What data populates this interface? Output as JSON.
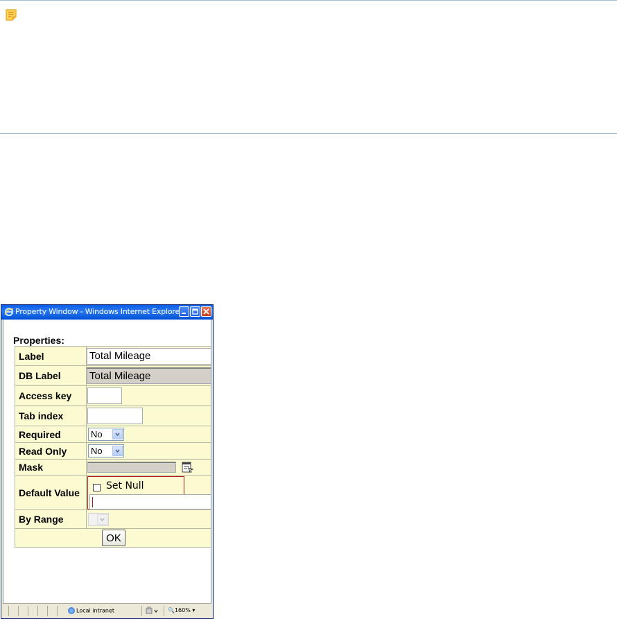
{
  "window": {
    "title": "Property Window - Windows Internet Explorer"
  },
  "properties": {
    "heading": "Properties:",
    "rows": {
      "label": {
        "label": "Label",
        "value": "Total Mileage"
      },
      "db_label": {
        "label": "DB Label",
        "value": "Total Mileage"
      },
      "access_key": {
        "label": "Access key",
        "value": ""
      },
      "tab_index": {
        "label": "Tab index",
        "value": ""
      },
      "required": {
        "label": "Required",
        "selected": "No"
      },
      "read_only": {
        "label": "Read Only",
        "selected": "No"
      },
      "mask": {
        "label": "Mask",
        "value": ""
      },
      "default_value": {
        "label": "Default Value",
        "set_null_label": "Set Null",
        "set_null_checked": false,
        "value": ""
      },
      "by_range": {
        "label": "By Range",
        "selected": ""
      }
    },
    "ok_label": "OK"
  },
  "statusbar": {
    "zone": "Local intranet",
    "zoom": "160%"
  },
  "colors": {
    "table_bg": "#fcfad0",
    "highlight_border": "#b01818",
    "titlebar": "#0a5de8"
  },
  "icons": {
    "note": "note-icon",
    "mask_picker": "mask-picker-icon",
    "ie": "ie-logo-icon"
  }
}
